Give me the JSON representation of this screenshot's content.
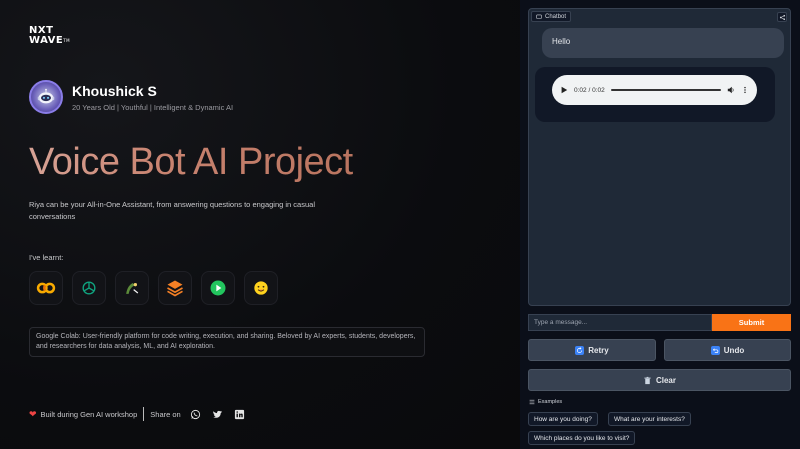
{
  "brand": {
    "logo_line1": "NXT",
    "logo_line2": "WAVE",
    "logo_tm": "TM"
  },
  "profile": {
    "name": "Khoushick S",
    "tagline": "20 Years Old | Youthful | Intelligent & Dynamic AI"
  },
  "hero": {
    "title": "Voice Bot AI Project",
    "description": "Riya can be your All-in-One Assistant, from answering questions to engaging in casual conversations"
  },
  "learnt": {
    "label": "I've learnt:",
    "tools": [
      {
        "name": "google-colab-icon"
      },
      {
        "name": "openai-icon"
      },
      {
        "name": "langchain-icon"
      },
      {
        "name": "stack-icon"
      },
      {
        "name": "play-icon"
      },
      {
        "name": "huggingface-icon"
      }
    ],
    "info_text": "Google Colab: User-friendly platform for code writing, execution, and sharing. Beloved by AI experts, students, developers, and researchers for data analysis, ML, and AI exploration."
  },
  "footer": {
    "built_text": "Built during Gen AI workshop",
    "share_text": "Share on"
  },
  "chat": {
    "label": "Chatbot",
    "messages": [
      {
        "role": "user",
        "text": "Hello"
      }
    ],
    "audio": {
      "time": "0:02 / 0:02",
      "progress": 1.0
    },
    "input_placeholder": "Type a message...",
    "submit_label": "Submit",
    "retry_label": "Retry",
    "undo_label": "Undo",
    "clear_label": "Clear",
    "examples_label": "Examples",
    "examples": [
      "How are you doing?",
      "What are your interests?",
      "Which places do you like to visit?"
    ]
  },
  "colors": {
    "accent": "#f97316",
    "title_gradient_start": "#d7a396",
    "panel_bg": "#1f2937",
    "button_bg": "#374151"
  }
}
